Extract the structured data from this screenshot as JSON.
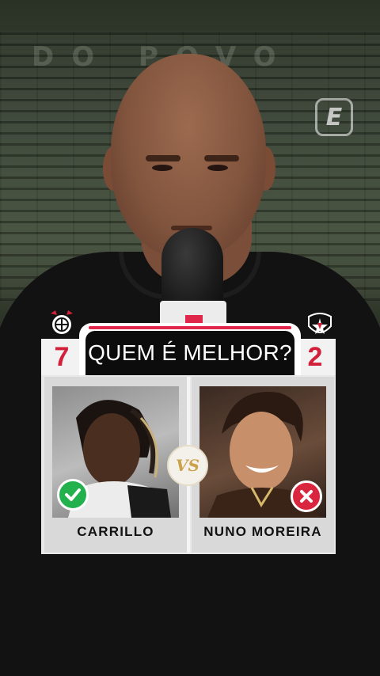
{
  "watermark": {
    "icon": "espn-e-icon",
    "glyph": "E"
  },
  "stadium": {
    "text": "DO POVO"
  },
  "comparison": {
    "title": "QUEM É MELHOR?",
    "left": {
      "score": "7",
      "name": "CARRILLO",
      "result_icon": "check-icon",
      "crest_icon": "corinthians-crest-icon"
    },
    "right": {
      "score": "2",
      "name": "NUNO MOREIRA",
      "result_icon": "x-icon",
      "crest_icon": "vasco-crest-icon"
    },
    "vs_label": "VS"
  },
  "colors": {
    "accent": "#e0264b",
    "score_text": "#d2203a",
    "check": "#22b14c",
    "cross": "#d9263e",
    "title_bg": "#0c0c0c",
    "vs_gold": "#c9a24a"
  }
}
